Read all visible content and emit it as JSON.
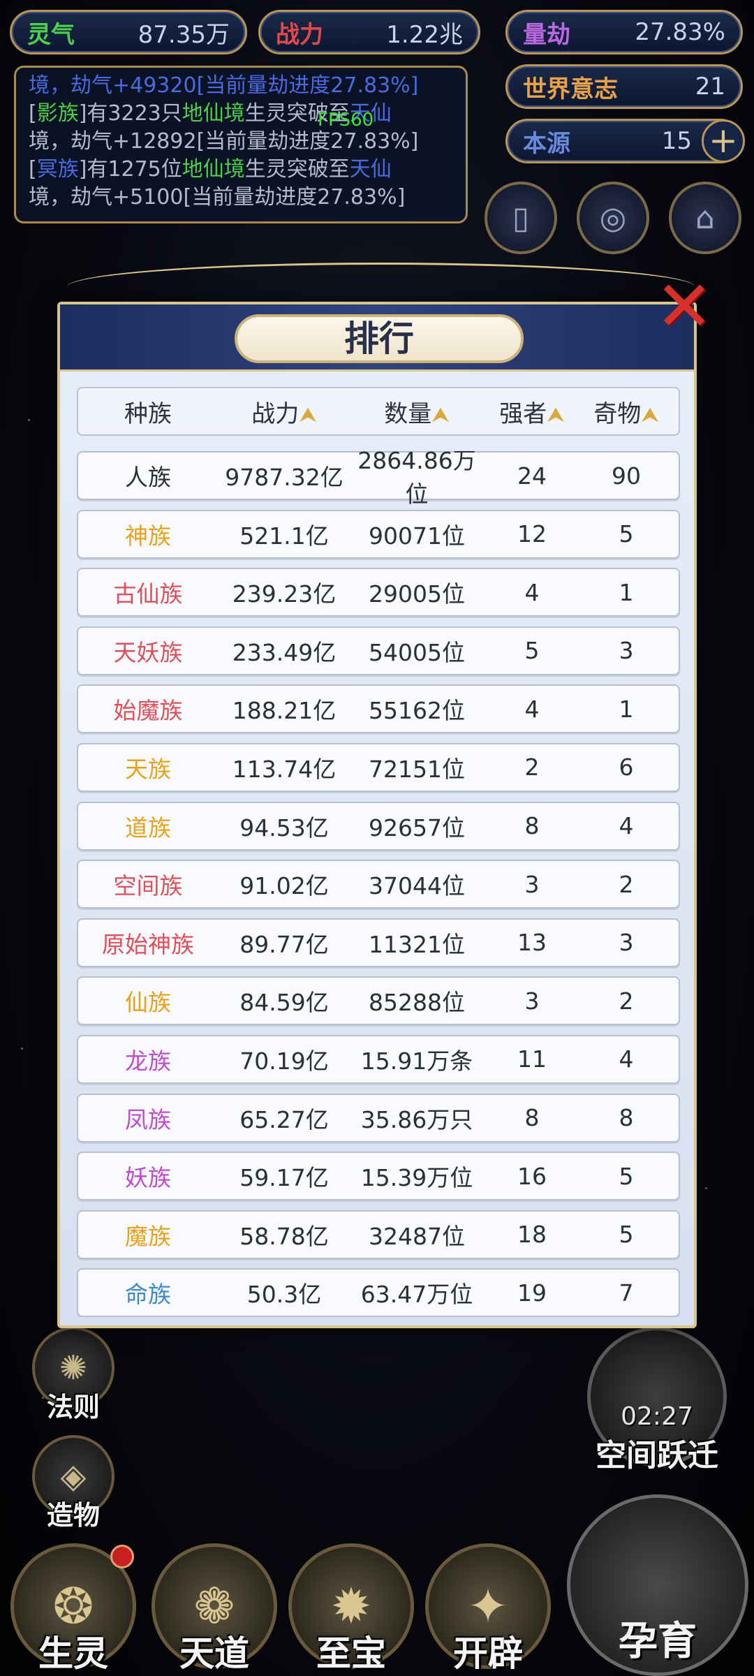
{
  "top_stats": {
    "lingqi": {
      "label": "灵气",
      "value": "87.35万"
    },
    "zhanli": {
      "label": "战力",
      "value": "1.22兆"
    },
    "liangjie": {
      "label": "量劫",
      "value": "27.83%"
    },
    "shijie": {
      "label": "世界意志",
      "value": "21"
    },
    "benyuan": {
      "label": "本源",
      "value": "15"
    }
  },
  "log": {
    "line1_a": "境，劫气+49320[当前量劫进度27.83%]",
    "line2_a": "[",
    "line2_race": "影族",
    "line2_b": "]有3223只",
    "line2_realm": "地仙境",
    "line2_c": "生灵突破至",
    "line2_target": "天仙",
    "line3": "境，劫气+12892[当前量劫进度27.83%]",
    "line4_a": "[",
    "line4_race": "冥族",
    "line4_b": "]有1275位",
    "line4_realm": "地仙境",
    "line4_c": "生灵突破至",
    "line4_target": "天仙",
    "line5": "境，劫气+5100[当前量劫进度27.83%]"
  },
  "fps": "FPS60",
  "modal": {
    "title": "排行",
    "close_icon": "✕",
    "headers": [
      "种族",
      "战力",
      "数量",
      "强者",
      "奇物"
    ],
    "sort_icon": "⮝",
    "rows": [
      {
        "race": "人族",
        "color": "#2b2f3a",
        "power": "9787.32亿",
        "count": "2864.86万位",
        "strong": "24",
        "item": "90"
      },
      {
        "race": "神族",
        "color": "#e8a21a",
        "power": "521.1亿",
        "count": "90071位",
        "strong": "12",
        "item": "5"
      },
      {
        "race": "古仙族",
        "color": "#e0505a",
        "power": "239.23亿",
        "count": "29005位",
        "strong": "4",
        "item": "1"
      },
      {
        "race": "天妖族",
        "color": "#e0505a",
        "power": "233.49亿",
        "count": "54005位",
        "strong": "5",
        "item": "3"
      },
      {
        "race": "始魔族",
        "color": "#e0505a",
        "power": "188.21亿",
        "count": "55162位",
        "strong": "4",
        "item": "1"
      },
      {
        "race": "天族",
        "color": "#e8a21a",
        "power": "113.74亿",
        "count": "72151位",
        "strong": "2",
        "item": "6"
      },
      {
        "race": "道族",
        "color": "#e8a21a",
        "power": "94.53亿",
        "count": "92657位",
        "strong": "8",
        "item": "4"
      },
      {
        "race": "空间族",
        "color": "#e0505a",
        "power": "91.02亿",
        "count": "37044位",
        "strong": "3",
        "item": "2"
      },
      {
        "race": "原始神族",
        "color": "#e0505a",
        "power": "89.77亿",
        "count": "11321位",
        "strong": "13",
        "item": "3"
      },
      {
        "race": "仙族",
        "color": "#e8a21a",
        "power": "84.59亿",
        "count": "85288位",
        "strong": "3",
        "item": "2"
      },
      {
        "race": "龙族",
        "color": "#c04ad0",
        "power": "70.19亿",
        "count": "15.91万条",
        "strong": "11",
        "item": "4"
      },
      {
        "race": "凤族",
        "color": "#c04ad0",
        "power": "65.27亿",
        "count": "35.86万只",
        "strong": "8",
        "item": "8"
      },
      {
        "race": "妖族",
        "color": "#c04ad0",
        "power": "59.17亿",
        "count": "15.39万位",
        "strong": "16",
        "item": "5"
      },
      {
        "race": "魔族",
        "color": "#e8a21a",
        "power": "58.78亿",
        "count": "32487位",
        "strong": "18",
        "item": "5"
      },
      {
        "race": "命族",
        "color": "#3a8ad0",
        "power": "50.3亿",
        "count": "63.47万位",
        "strong": "19",
        "item": "7"
      }
    ]
  },
  "side_menu": {
    "faze": "法则",
    "zaowu": "造物"
  },
  "bottom_menu": {
    "shengling": "生灵",
    "tiandao": "天道",
    "zhibao": "至宝",
    "kaipi": "开辟"
  },
  "timer": {
    "time": "02:27",
    "label": "空间跃迁"
  },
  "yunyu": "孕育"
}
